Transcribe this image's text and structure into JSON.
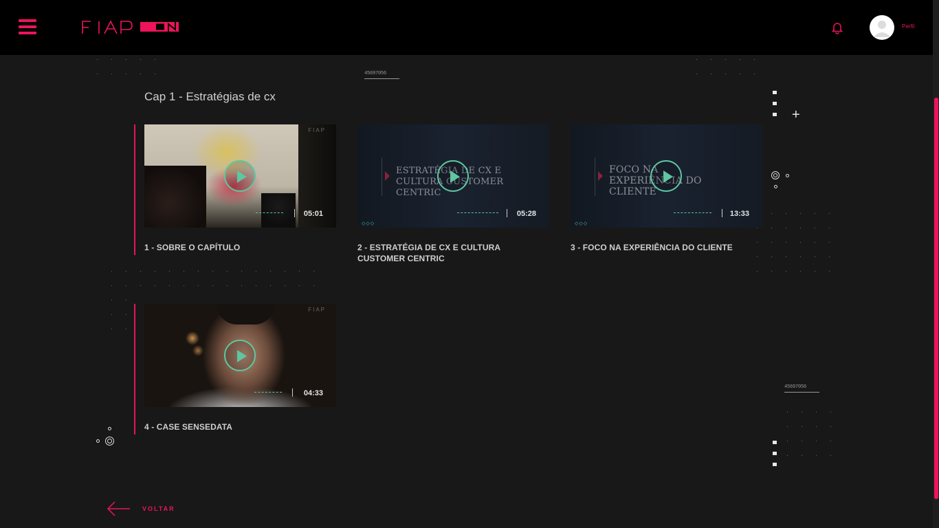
{
  "header": {
    "logo_text": "FIAP ON",
    "profile_label": "Perfil"
  },
  "decorations": {
    "code_top": "45697056",
    "code_right": "45697056"
  },
  "section": {
    "title": "Cap 1 - Estratégias de cx"
  },
  "videos": [
    {
      "title": "1 - SOBRE O CAPÍTULO",
      "duration": "05:01",
      "slide_text": "",
      "corner": "FIAP"
    },
    {
      "title": "2 - ESTRATÉGIA DE CX E CULTURA CUSTOMER CENTRIC",
      "duration": "05:28",
      "slide_text": "ESTRATÉGIA DE CX E CULTURA CUSTOMER CENTRIC",
      "corner": ""
    },
    {
      "title": "3 - FOCO NA EXPERIÊNCIA DO CLIENTE",
      "duration": "13:33",
      "slide_text": "FOCO NA EXPERIÊNCIA DO CLIENTE",
      "corner": ""
    },
    {
      "title": "4 - CASE SENSEDATA",
      "duration": "04:33",
      "slide_text": "",
      "corner": "FIAP"
    }
  ],
  "footer": {
    "back_label": "VOLTAR"
  },
  "colors": {
    "accent": "#ed145b",
    "play": "#5ec6a0",
    "background": "#181818",
    "header": "#000000"
  }
}
